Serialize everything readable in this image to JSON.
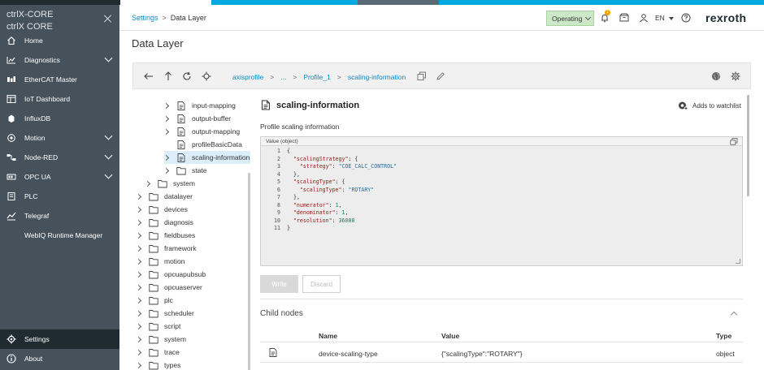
{
  "topband_colors": [
    "#1f2a31",
    "#ffffff",
    "#00a8e0",
    "#1f2a31",
    "#00a8e0"
  ],
  "sidebar": {
    "brand_line1": "ctrlX-CORE",
    "brand_line2": "ctrlX CORE",
    "items": [
      {
        "label": "Home",
        "icon": "home-icon"
      },
      {
        "label": "Diagnostics",
        "icon": "diagnostics-icon",
        "expandable": true
      },
      {
        "label": "EtherCAT Master",
        "icon": "ethercat-icon"
      },
      {
        "label": "IoT Dashboard",
        "icon": "dashboard-icon"
      },
      {
        "label": "InfluxDB",
        "icon": "database-icon"
      },
      {
        "label": "Motion",
        "icon": "motion-icon",
        "expandable": true
      },
      {
        "label": "Node-RED",
        "icon": "node-red-icon",
        "expandable": true
      },
      {
        "label": "OPC UA",
        "icon": "opcua-icon",
        "expandable": true
      },
      {
        "label": "PLC",
        "icon": "plc-icon"
      },
      {
        "label": "Telegraf",
        "icon": "telegraf-icon"
      },
      {
        "label": "WebIQ Runtime Manager",
        "icon": ""
      }
    ],
    "settings_label": "Settings",
    "about_label": "About"
  },
  "header": {
    "crumb_root": "Settings",
    "crumb_sep": ">",
    "crumb_current": "Data Layer",
    "status": "Operating",
    "notification_count": "1",
    "language": "EN",
    "logo": "rexroth"
  },
  "page": {
    "title": "Data Layer"
  },
  "toolbar": {
    "path": [
      "axisprofile",
      "...",
      "Profile_1",
      "scaling-information"
    ],
    "path_sep": ">"
  },
  "tree": [
    {
      "label": "input-mapping",
      "indent": 2,
      "chev": true,
      "icon": "file"
    },
    {
      "label": "output-buffer",
      "indent": 2,
      "chev": true,
      "icon": "file"
    },
    {
      "label": "output-mapping",
      "indent": 2,
      "chev": true,
      "icon": "file"
    },
    {
      "label": "profileBasicData",
      "indent": 2,
      "chev": false,
      "icon": "file"
    },
    {
      "label": "scaling-information",
      "indent": 2,
      "chev": true,
      "icon": "file",
      "selected": true
    },
    {
      "label": "state",
      "indent": 2,
      "chev": true,
      "icon": "folder"
    },
    {
      "label": "system",
      "indent": 1,
      "chev": true,
      "icon": "folder"
    },
    {
      "label": "datalayer",
      "indent": 0,
      "chev": true,
      "icon": "folder"
    },
    {
      "label": "devices",
      "indent": 0,
      "chev": true,
      "icon": "folder"
    },
    {
      "label": "diagnosis",
      "indent": 0,
      "chev": true,
      "icon": "folder"
    },
    {
      "label": "fieldbuses",
      "indent": 0,
      "chev": true,
      "icon": "folder"
    },
    {
      "label": "framework",
      "indent": 0,
      "chev": true,
      "icon": "folder"
    },
    {
      "label": "motion",
      "indent": 0,
      "chev": true,
      "icon": "folder"
    },
    {
      "label": "opcuapubsub",
      "indent": 0,
      "chev": true,
      "icon": "folder"
    },
    {
      "label": "opcuaserver",
      "indent": 0,
      "chev": true,
      "icon": "folder"
    },
    {
      "label": "plc",
      "indent": 0,
      "chev": true,
      "icon": "folder"
    },
    {
      "label": "scheduler",
      "indent": 0,
      "chev": true,
      "icon": "folder"
    },
    {
      "label": "script",
      "indent": 0,
      "chev": true,
      "icon": "folder"
    },
    {
      "label": "system",
      "indent": 0,
      "chev": true,
      "icon": "folder"
    },
    {
      "label": "trace",
      "indent": 0,
      "chev": true,
      "icon": "folder"
    },
    {
      "label": "types",
      "indent": 0,
      "chev": true,
      "icon": "folder"
    }
  ],
  "detail": {
    "title": "scaling-information",
    "watchlist_label": "Adds to watchlist",
    "description": "Profile scaling information",
    "value_label": "Value (object)",
    "code_lines": [
      "{",
      "  \"scalingStrategy\": {",
      "    \"strategy\": \"COE_CALC_CONTROL\"",
      "  },",
      "  \"scalingType\": {",
      "    \"scalingType\": \"ROTARY\"",
      "  },",
      "  \"numerator\": 1,",
      "  \"denominator\": 1,",
      "  \"resolution\": 36000",
      "}"
    ],
    "write_label": "Write",
    "discard_label": "Discard",
    "child_nodes_label": "Child nodes",
    "table": {
      "headers": {
        "name": "Name",
        "value": "Value",
        "type": "Type"
      },
      "rows": [
        {
          "name": "device-scaling-type",
          "value": "{\"scalingType\":\"ROTARY\"}",
          "type": "object"
        }
      ]
    }
  }
}
